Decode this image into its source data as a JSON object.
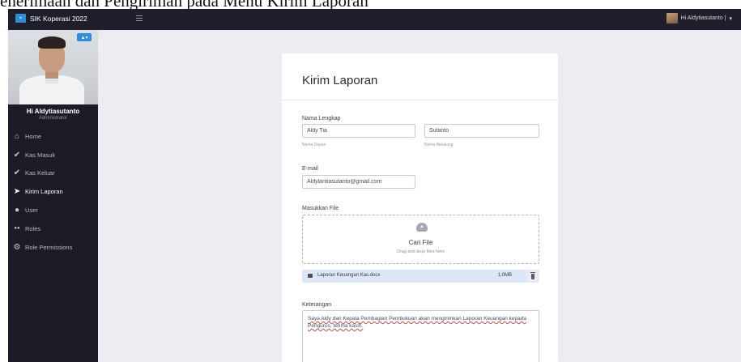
{
  "caption": "enerimaan dan Pengiriman pada Menu Kirim Laporan",
  "app": {
    "brand": "SIK Koperasi 2022",
    "user_menu_label": "Hi Aldytiasutanto |",
    "user_menu_caret": "▾"
  },
  "sidebar": {
    "photo_badge": "▲▾",
    "profile_name": "Hi Aldytiasutanto",
    "profile_role": "Administrator",
    "items": [
      {
        "label": "Home",
        "icon": "home-icon",
        "glyph": "⌂"
      },
      {
        "label": "Kas Masuk",
        "icon": "check-circle-icon",
        "glyph": "✔"
      },
      {
        "label": "Kas Keluar",
        "icon": "check-circle-icon",
        "glyph": "✔"
      },
      {
        "label": "Kirim Laporan",
        "icon": "paper-plane-icon",
        "glyph": "➤"
      },
      {
        "label": "User",
        "icon": "user-icon",
        "glyph": "●"
      },
      {
        "label": "Roles",
        "icon": "users-icon",
        "glyph": "●●"
      },
      {
        "label": "Role Permissions",
        "icon": "cogs-icon",
        "glyph": "⚙"
      }
    ]
  },
  "form": {
    "title": "Kirim Laporan",
    "name_label": "Nama Lengkap",
    "first_name_value": "Aldy Tia",
    "last_name_value": "Sutanto",
    "first_name_hint": "Nama Depan",
    "last_name_hint": "Nama Belakang",
    "email_label": "E-mail",
    "email_value": "Aldylantiasutanto@gmail.com",
    "file_label": "Masukkan File",
    "dropzone_title": "Cari File",
    "dropzone_sub": "Drag and drop files here",
    "file_name": "Laporan Keuangan Kas.docx",
    "file_size": "1,0MB",
    "notes_label": "Keterangan",
    "notes_value": "Saya Aldy dari Kepala Pembagian Pembukuan akan mengirimkan Laporan Keuangan kepada Pengurus, terima kasih."
  }
}
